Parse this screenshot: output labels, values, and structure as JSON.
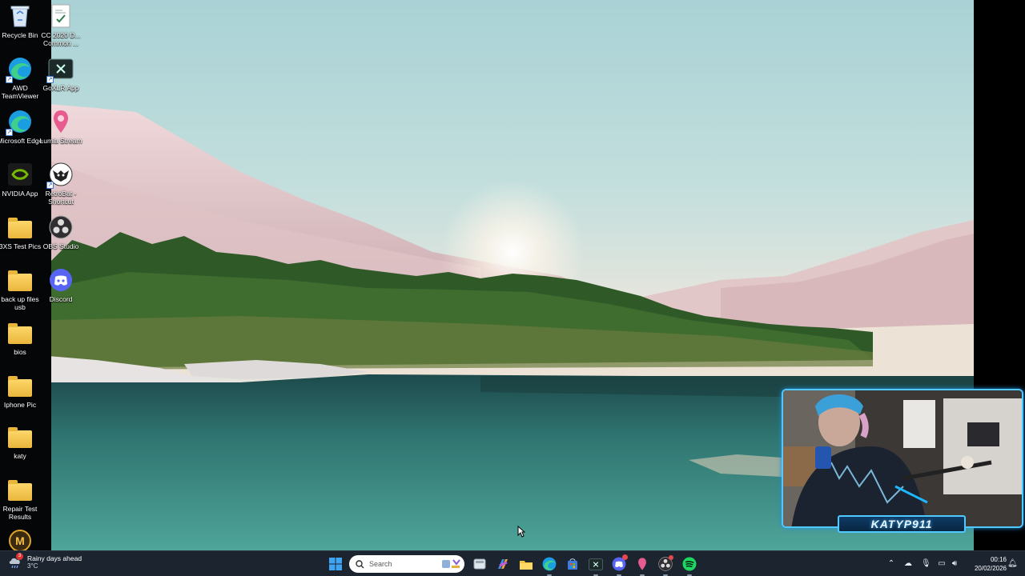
{
  "desktop_icons": [
    {
      "label": "Recycle Bin",
      "icon": "recycle-bin-icon"
    },
    {
      "label": "CC 2020 D... Common ...",
      "icon": "document-icon"
    },
    {
      "label": "AWD TeamViewer",
      "icon": "edge-icon"
    },
    {
      "label": "GoXLR App",
      "icon": "goxlr-icon"
    },
    {
      "label": "Microsoft Edge",
      "icon": "edge-icon"
    },
    {
      "label": "Lumia Stream",
      "icon": "lumia-stream-icon"
    },
    {
      "label": "NVIDIA App",
      "icon": "nvidia-icon"
    },
    {
      "label": "RetroBat - Shortcut",
      "icon": "retrobat-icon"
    },
    {
      "label": "3XS Test Pics",
      "icon": "folder-icon"
    },
    {
      "label": "OBS Studio",
      "icon": "obs-icon"
    },
    {
      "label": "back up files usb",
      "icon": "folder-icon"
    },
    {
      "label": "Discord",
      "icon": "discord-icon"
    },
    {
      "label": "bios",
      "icon": "folder-icon"
    },
    {
      "label": "Iphone Pic",
      "icon": "folder-icon"
    },
    {
      "label": "katy",
      "icon": "folder-icon"
    },
    {
      "label": "Repair Test Results",
      "icon": "folder-icon"
    },
    {
      "label": "",
      "icon": "app-m-icon"
    }
  ],
  "webcam": {
    "name": "KATYP911"
  },
  "taskbar": {
    "weather": {
      "title": "Rainy days ahead",
      "temp": "3°C",
      "badge": "3"
    },
    "search_placeholder": "Search",
    "apps": [
      "start-icon",
      "task-view-icon",
      "copilot-icon",
      "file-explorer-icon",
      "edge-icon",
      "store-icon",
      "goxlr-icon",
      "discord-icon",
      "lumia-stream-icon",
      "obs-icon",
      "spotify-icon"
    ],
    "clock": {
      "time": "00:16",
      "date": "20/02/2026"
    }
  },
  "colors": {
    "accent": "#4fc9ff",
    "taskbar": "#1c2430"
  }
}
